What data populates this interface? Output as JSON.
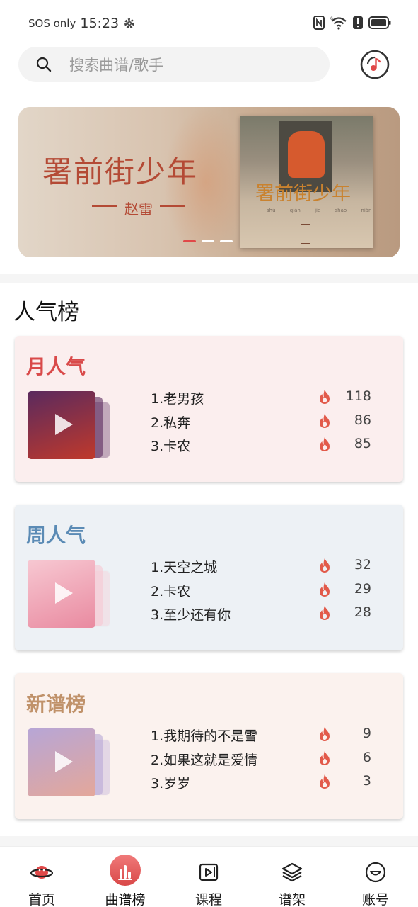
{
  "status_bar": {
    "carrier": "SOS only",
    "time": "15:23",
    "icons": [
      "gear-icon",
      "nfc-icon",
      "wifi-icon",
      "alert-icon",
      "battery-icon"
    ]
  },
  "search": {
    "placeholder": "搜索曲谱/歌手",
    "icon": "search-icon",
    "music_button_icon": "music-disc-icon"
  },
  "banner": {
    "title": "署前街少年",
    "artist": "赵雷",
    "album_title": "署前街少年",
    "album_pinyin": "shǔ qián jiē shào nián",
    "album_seal": "赵雷",
    "slides_total": 3,
    "active_slide": 1,
    "accent_color": "#e04848"
  },
  "section_title": "人气榜",
  "charts": [
    {
      "title": "月人气",
      "title_color": "#d94a4a",
      "bg_color": "#fbeeee",
      "cover_colors": [
        "#5a2a5e",
        "#c0392b"
      ],
      "items": [
        {
          "name": "1.老男孩",
          "count": "118"
        },
        {
          "name": "2.私奔",
          "count": "86"
        },
        {
          "name": "3.卡农",
          "count": "85"
        }
      ]
    },
    {
      "title": "周人气",
      "title_color": "#5b8bb5",
      "bg_color": "#edf1f5",
      "cover_colors": [
        "#f7c8d2",
        "#e98aa0"
      ],
      "items": [
        {
          "name": "1.天空之城",
          "count": "32"
        },
        {
          "name": "2.卡农",
          "count": "29"
        },
        {
          "name": "3.至少还有你",
          "count": "28"
        }
      ]
    },
    {
      "title": "新谱榜",
      "title_color": "#c0926a",
      "bg_color": "#fbf2ee",
      "cover_colors": [
        "#b7a6d6",
        "#e4a79a"
      ],
      "items": [
        {
          "name": "1.我期待的不是雪",
          "count": "9"
        },
        {
          "name": "2.如果这就是爱情",
          "count": "6"
        },
        {
          "name": "3.岁岁",
          "count": "3"
        }
      ]
    }
  ],
  "fire_color": "#e25a4a",
  "bottom_nav": [
    {
      "label": "首页",
      "icon": "planet-icon",
      "active": false
    },
    {
      "label": "曲谱榜",
      "icon": "chart-bars-icon",
      "active": true
    },
    {
      "label": "课程",
      "icon": "video-play-icon",
      "active": false
    },
    {
      "label": "谱架",
      "icon": "layers-icon",
      "active": false
    },
    {
      "label": "账号",
      "icon": "smile-face-icon",
      "active": false
    }
  ]
}
